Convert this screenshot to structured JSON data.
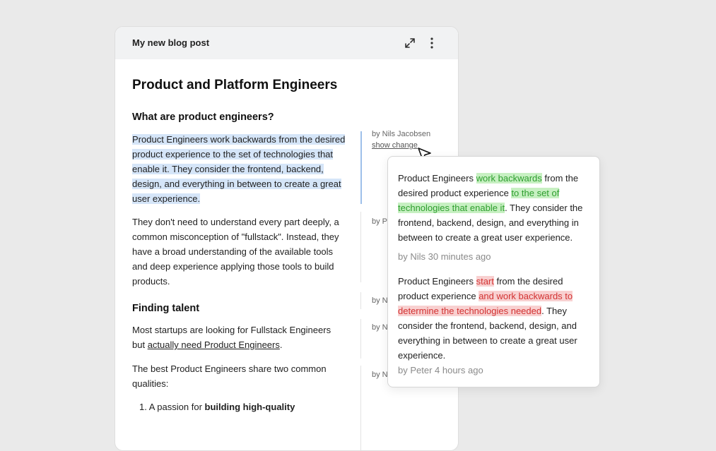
{
  "card": {
    "title": "My new blog post",
    "expand_icon": "expand-icon",
    "more_icon": "more-vertical-icon"
  },
  "doc": {
    "title": "Product and Platform Engineers",
    "section1_heading": "What are product engineers?",
    "para1": "Product Engineers work backwards from the desired product experience to the set of technologies that enable it. They consider the frontend, backend, design, and everything in between to create a great user experience.",
    "para2": "They don't need to understand every part deeply, a common misconception of \"fullstack\". Instead, they have a broad understanding of the available tools and deep experience applying those tools to build products.",
    "section2_heading": "Finding talent",
    "para3_prefix": "Most startups are looking for Fullstack Engineers but ",
    "para3_link": "actually need Product Engineers",
    "para3_suffix": ".",
    "para4": "The best Product Engineers share two common qualities:",
    "list_item1_prefix": "1. A passion for ",
    "list_item1_bold": "building high-quality"
  },
  "gutter": {
    "active_by": "by Nils Jacobsen",
    "show_change": "show change",
    "by_truncated": [
      "by P",
      "by N",
      "by N",
      "by N"
    ]
  },
  "popover": {
    "change1": {
      "p1": "Product Engineers ",
      "a1": "work backwards",
      "p2": " from the desired product experience ",
      "a2": "to the set of technologies that enable it",
      "p3": ". They consider the frontend, backend, design, and everything in between to create a great user experience.",
      "meta": "by Nils 30 minutes ago"
    },
    "change2": {
      "p1": "Product Engineers ",
      "d1": "start",
      "p2": " from the desired product experience ",
      "d2": "and work backwards to determine the technologies needed",
      "p3": ". They consider the frontend, backend, design, and everything in between to create a great user experience.",
      "meta": "by Peter 4 hours ago"
    }
  },
  "colors": {
    "selection": "#d5e5f8",
    "addition_bg": "#c7f0c2",
    "addition_text": "#2e9e2e",
    "deletion_bg": "#f8d0d0",
    "deletion_text": "#d23232"
  }
}
